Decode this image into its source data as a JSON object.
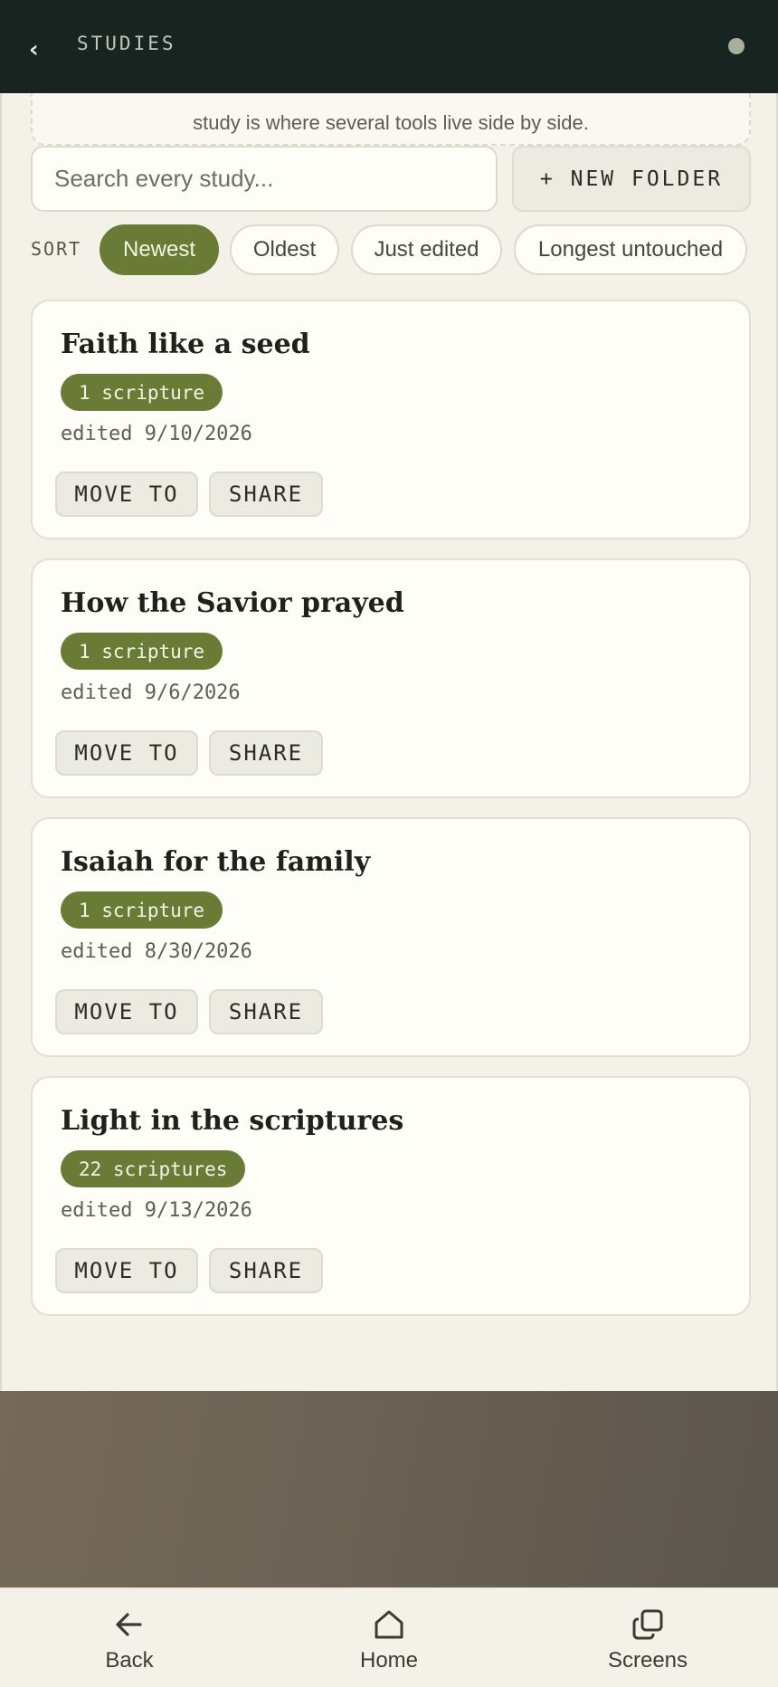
{
  "header": {
    "back_glyph": "‹",
    "title": "STUDIES"
  },
  "intro": {
    "text": "study is where several tools live side by side."
  },
  "search": {
    "placeholder": "Search every study..."
  },
  "toolbar": {
    "new_folder_label": "+ NEW FOLDER"
  },
  "sort": {
    "label": "SORT",
    "options": [
      "Newest",
      "Oldest",
      "Just edited",
      "Longest untouched"
    ],
    "selected": "Newest"
  },
  "studies": [
    {
      "title": "Faith like a seed",
      "scripture_count": "1 scripture",
      "edited": "edited 9/10/2026"
    },
    {
      "title": "How the Savior prayed",
      "scripture_count": "1 scripture",
      "edited": "edited 9/6/2026"
    },
    {
      "title": "Isaiah for the family",
      "scripture_count": "1 scripture",
      "edited": "edited 8/30/2026"
    },
    {
      "title": "Light in the scriptures",
      "scripture_count": "22 scriptures",
      "edited": "edited 9/13/2026"
    }
  ],
  "card_actions": {
    "move_label": "MOVE TO",
    "share_label": "SHARE"
  },
  "navbar": {
    "back_label": "Back",
    "home_label": "Home",
    "screens_label": "Screens"
  },
  "colors": {
    "topbar": "#18241f",
    "accent": "#6a7b35",
    "background": "#f4f2e8",
    "card": "#fefdf7"
  },
  "icons": {
    "header_back": "chevron-left-icon",
    "status": "status-dot-icon",
    "nav_back": "arrow-left-icon",
    "nav_home": "home-icon",
    "nav_screens": "overlapping-squares-icon"
  }
}
